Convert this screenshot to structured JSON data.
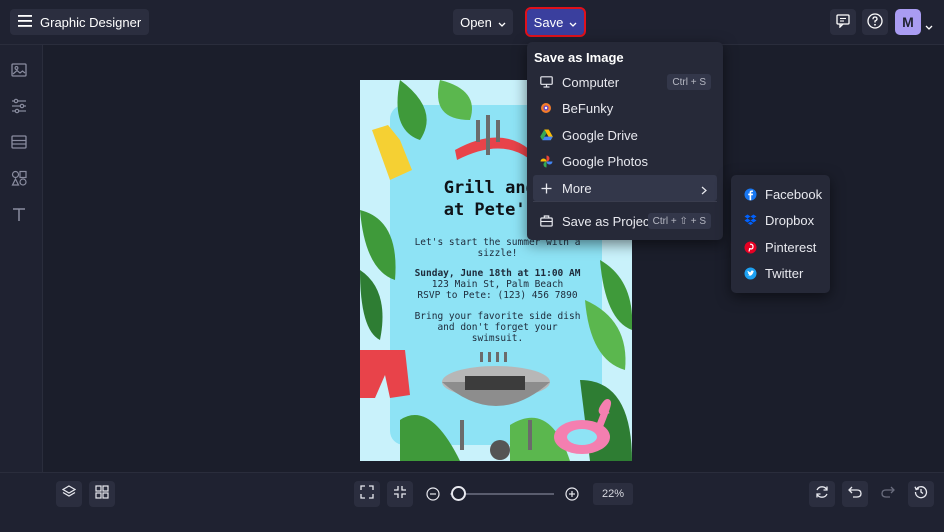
{
  "app": {
    "title": "Graphic Designer"
  },
  "toolbar": {
    "open_label": "Open",
    "save_label": "Save",
    "avatar_initial": "M"
  },
  "save_menu": {
    "header": "Save as Image",
    "items": [
      {
        "label": "Computer",
        "shortcut": "Ctrl + S",
        "icon": "monitor-icon"
      },
      {
        "label": "BeFunky",
        "shortcut": "",
        "icon": "befunky-icon"
      },
      {
        "label": "Google Drive",
        "shortcut": "",
        "icon": "google-drive-icon"
      },
      {
        "label": "Google Photos",
        "shortcut": "",
        "icon": "google-photos-icon"
      },
      {
        "label": "More",
        "shortcut": "",
        "icon": "plus-icon"
      },
      {
        "label": "Save as Project",
        "shortcut": "Ctrl + ⇧ + S",
        "icon": "briefcase-icon"
      }
    ]
  },
  "more_menu": {
    "items": [
      {
        "label": "Facebook",
        "icon": "facebook-icon",
        "color": "#1877f2"
      },
      {
        "label": "Dropbox",
        "icon": "dropbox-icon",
        "color": "#0061fe"
      },
      {
        "label": "Pinterest",
        "icon": "pinterest-icon",
        "color": "#e60023"
      },
      {
        "label": "Twitter",
        "icon": "twitter-icon",
        "color": "#1da1f2"
      }
    ]
  },
  "poster": {
    "title_line1": "Grill and C",
    "title_line2": "at Pete's P",
    "intro": "Let's start the summer with a sizzle!",
    "date": "Sunday, June 18th at 11:00 AM",
    "address": "123 Main St, Palm Beach",
    "rsvp": "RSVP to Pete: (123) 456 7890",
    "note": "Bring your favorite side dish and don't forget your swimsuit."
  },
  "zoom": {
    "value": "22%",
    "level": 0.0
  },
  "colors": {
    "accent": "#3a3f9e",
    "highlight_outline": "#e0111b",
    "avatar": "#a99cf2"
  }
}
